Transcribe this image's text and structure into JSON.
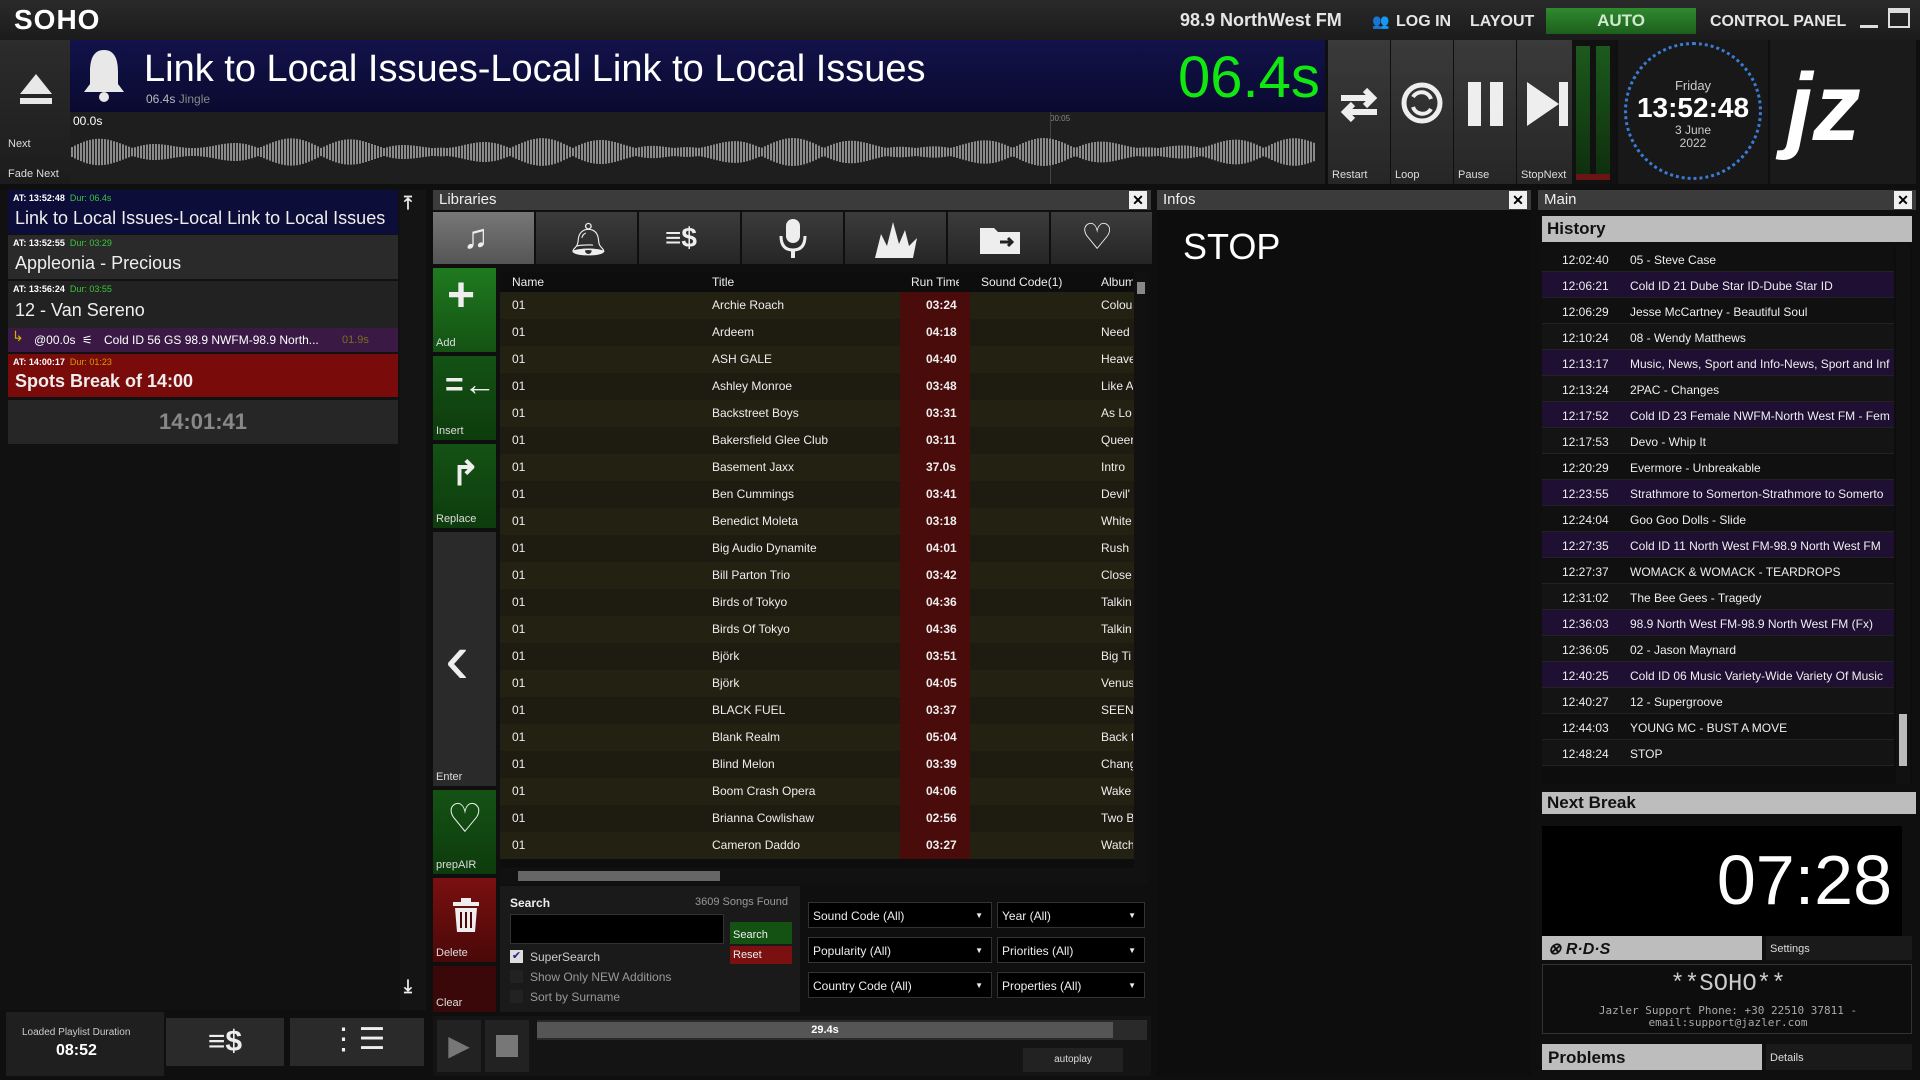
{
  "app": {
    "logo": "SOHO",
    "station": "98.9 NorthWest FM",
    "login": "LOG IN",
    "layout": "LAYOUT",
    "auto": "AUTO",
    "control_panel": "CONTROL PANEL"
  },
  "now_playing": {
    "title": "Link to Local Issues-Local Link to Local Issues",
    "duration": "06.4s",
    "type": "Jingle",
    "countdown": "06.4s",
    "position": "00.0s",
    "marker": "00:05"
  },
  "deck_left": {
    "next": "Next",
    "fade_next": "Fade Next"
  },
  "controls": {
    "restart": "Restart",
    "loop": "Loop",
    "pause": "Pause",
    "stopnext": "StopNext"
  },
  "clock": {
    "day": "Friday",
    "time": "13:52:48",
    "date": "3 June",
    "year": "2022"
  },
  "playlist": {
    "items": [
      {
        "at": "AT: 13:52:48",
        "dur": "Dur: 06.4s",
        "title": "Link to Local Issues-Local Link to Local Issues"
      },
      {
        "at": "AT: 13:52:55",
        "dur": "Dur: 03:29",
        "title": "Appleonia - Precious"
      },
      {
        "at": "AT: 13:56:24",
        "dur": "Dur: 03:55",
        "title": "12 - Van Sereno"
      },
      {
        "at": "AT: 14:00:17",
        "dur": "Dur: 01:23",
        "title": "Spots Break of 14:00"
      }
    ],
    "overlay": {
      "at": "@00.0s",
      "title": "Cold ID 56 GS 98.9 NWFM-98.9 North...",
      "dur": "01.9s"
    },
    "end_time": "14:01:41",
    "loaded_label": "Loaded Playlist Duration",
    "loaded_value": "08:52"
  },
  "libraries": {
    "title": "Libraries",
    "tabs": [
      "music-icon",
      "bell-icon",
      "spots-icon",
      "microphone-icon",
      "fx-icon",
      "folder-icon",
      "heart-plus-icon"
    ],
    "side": {
      "add": "Add",
      "insert": "Insert",
      "replace": "Replace",
      "enter": "Enter",
      "prepair": "prepAIR",
      "delete": "Delete",
      "clear": "Clear"
    },
    "columns": {
      "name": "Name",
      "title": "Title",
      "runtime": "Run Time",
      "soundcode": "Sound Code(1)",
      "album": "Album"
    },
    "rows": [
      {
        "name": "01",
        "title": "Archie Roach",
        "time": "03:24",
        "album": "Colou"
      },
      {
        "name": "01",
        "title": "Ardeem",
        "time": "04:18",
        "album": "Need"
      },
      {
        "name": "01",
        "title": "ASH GALE",
        "time": "04:40",
        "album": "Heave"
      },
      {
        "name": "01",
        "title": "Ashley Monroe",
        "time": "03:48",
        "album": "Like A"
      },
      {
        "name": "01",
        "title": "Backstreet Boys",
        "time": "03:31",
        "album": "As Lo"
      },
      {
        "name": "01",
        "title": "Bakersfield Glee Club",
        "time": "03:11",
        "album": "Queer"
      },
      {
        "name": "01",
        "title": "Basement Jaxx",
        "time": "37.0s",
        "album": "Intro"
      },
      {
        "name": "01",
        "title": "Ben Cummings",
        "time": "03:41",
        "album": "Devil'"
      },
      {
        "name": "01",
        "title": "Benedict Moleta",
        "time": "03:18",
        "album": "White"
      },
      {
        "name": "01",
        "title": "Big Audio Dynamite",
        "time": "04:01",
        "album": "Rush"
      },
      {
        "name": "01",
        "title": "Bill Parton Trio",
        "time": "03:42",
        "album": "Close"
      },
      {
        "name": "01",
        "title": "Birds of Tokyo",
        "time": "04:36",
        "album": "Talkin"
      },
      {
        "name": "01",
        "title": "Birds Of Tokyo",
        "time": "04:36",
        "album": "Talkin"
      },
      {
        "name": "01",
        "title": "Björk",
        "time": "03:51",
        "album": "Big Ti"
      },
      {
        "name": "01",
        "title": "Björk",
        "time": "04:05",
        "album": "Venus"
      },
      {
        "name": "01",
        "title": "BLACK FUEL",
        "time": "03:37",
        "album": "SEEN"
      },
      {
        "name": "01",
        "title": "Blank Realm",
        "time": "05:04",
        "album": "Back t"
      },
      {
        "name": "01",
        "title": "Blind Melon",
        "time": "03:39",
        "album": "Chang"
      },
      {
        "name": "01",
        "title": "Boom Crash Opera",
        "time": "04:06",
        "album": "Wake"
      },
      {
        "name": "01",
        "title": "Brianna Cowlishaw",
        "time": "02:56",
        "album": "Two B"
      },
      {
        "name": "01",
        "title": "Cameron Daddo",
        "time": "03:27",
        "album": "Watch"
      }
    ],
    "search_label": "Search",
    "songs_found": "3609 Songs Found",
    "search_btn": "Search",
    "reset_btn": "Reset",
    "supersearch": "SuperSearch",
    "new_additions": "Show Only NEW Additions",
    "sort_surname": "Sort by Surname",
    "filters": {
      "sound_code": "Sound Code (All)",
      "year": "Year (All)",
      "popularity": "Popularity (All)",
      "priorities": "Priorities (All)",
      "country": "Country Code (All)",
      "properties": "Properties (All)"
    },
    "progress": "29.4s",
    "autoplay": "autoplay"
  },
  "infos": {
    "title": "Infos",
    "status": "STOP"
  },
  "main": {
    "title": "Main",
    "history_title": "History",
    "history": [
      {
        "time": "12:02:40",
        "title": "05 - Steve Case",
        "hl": false
      },
      {
        "time": "12:06:21",
        "title": "Cold ID 21 Dube Star ID-Dube Star ID",
        "hl": true
      },
      {
        "time": "12:06:29",
        "title": "Jesse McCartney - Beautiful Soul",
        "hl": false
      },
      {
        "time": "12:10:24",
        "title": "08 - Wendy Matthews",
        "hl": false
      },
      {
        "time": "12:13:17",
        "title": "Music, News, Sport and Info-News, Sport and Inf",
        "hl": true
      },
      {
        "time": "12:13:24",
        "title": "2PAC - Changes",
        "hl": false
      },
      {
        "time": "12:17:52",
        "title": "Cold ID 23 Female NWFM-North West FM - Fem",
        "hl": true
      },
      {
        "time": "12:17:53",
        "title": "Devo - Whip It",
        "hl": false
      },
      {
        "time": "12:20:29",
        "title": "Evermore - Unbreakable",
        "hl": false
      },
      {
        "time": "12:23:55",
        "title": "Strathmore to Somerton-Strathmore to Somerto",
        "hl": true
      },
      {
        "time": "12:24:04",
        "title": "Goo Goo Dolls - Slide",
        "hl": false
      },
      {
        "time": "12:27:35",
        "title": "Cold ID 11 North West FM-98.9 North West FM",
        "hl": true
      },
      {
        "time": "12:27:37",
        "title": "WOMACK & WOMACK - TEARDROPS",
        "hl": false
      },
      {
        "time": "12:31:02",
        "title": "The Bee Gees - Tragedy",
        "hl": false
      },
      {
        "time": "12:36:03",
        "title": "98.9 North West FM-98.9 North West FM (Fx)",
        "hl": true
      },
      {
        "time": "12:36:05",
        "title": "02 - Jason Maynard",
        "hl": false
      },
      {
        "time": "12:40:25",
        "title": "Cold ID 06 Music Variety-Wide Variety Of Music",
        "hl": true
      },
      {
        "time": "12:40:27",
        "title": "12 - Supergroove",
        "hl": false
      },
      {
        "time": "12:44:03",
        "title": "YOUNG MC - BUST A MOVE",
        "hl": false
      },
      {
        "time": "12:48:24",
        "title": "STOP",
        "hl": false
      }
    ],
    "next_break_title": "Next Break",
    "next_break": "07:28",
    "rds": "R·D·S",
    "settings": "Settings",
    "rds_text": "**SOHO**",
    "support": "Jazler Support Phone: +30 22510 37811 - email:support@jazler.com",
    "problems": "Problems",
    "details": "Details"
  }
}
